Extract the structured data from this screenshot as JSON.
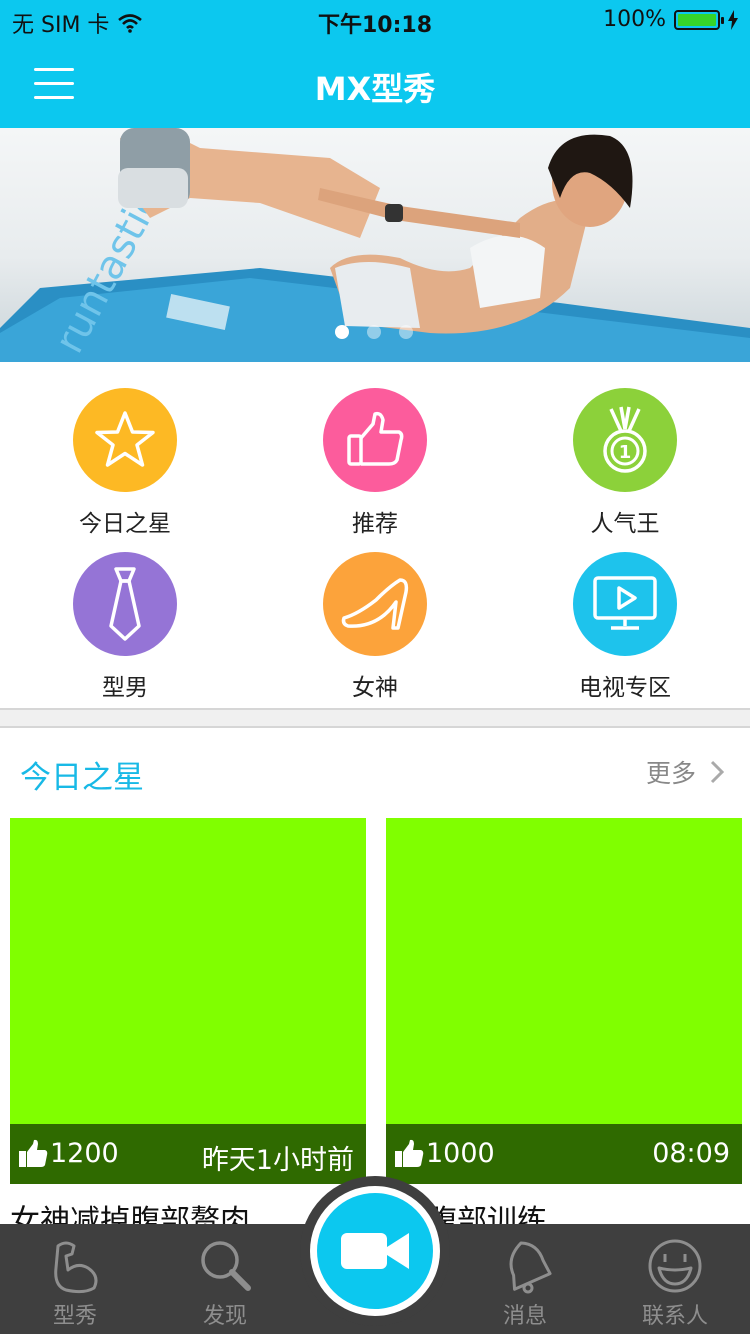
{
  "status_bar": {
    "carrier": "无 SIM 卡",
    "time": "下午10:18",
    "battery": "100%"
  },
  "nav": {
    "title": "MX型秀"
  },
  "banner": {
    "slides": 3,
    "active_slide": 1,
    "mat_brand": "runtastic"
  },
  "categories": [
    {
      "label": "今日之星",
      "icon": "star-icon",
      "color": "#fdb924"
    },
    {
      "label": "推荐",
      "icon": "thumbs-up-icon",
      "color": "#fc5c9c"
    },
    {
      "label": "人气王",
      "icon": "medal-icon",
      "color": "#8cd13a"
    },
    {
      "label": "型男",
      "icon": "tie-icon",
      "color": "#9574d6"
    },
    {
      "label": "女神",
      "icon": "high-heel-icon",
      "color": "#fca33b"
    },
    {
      "label": "电视专区",
      "icon": "tv-play-icon",
      "color": "#1ec3ec"
    }
  ],
  "section": {
    "title": "今日之星",
    "more": "更多"
  },
  "cards": [
    {
      "likes": "1200",
      "time": "昨天1小时前",
      "title": "女神减掉腹部赘肉"
    },
    {
      "likes": "1000",
      "time": "08:09",
      "title": "腹部训练"
    }
  ],
  "tabs": [
    {
      "label": "型秀",
      "icon": "muscle-arm-icon"
    },
    {
      "label": "发现",
      "icon": "search-icon"
    },
    {
      "label": "消息",
      "icon": "bell-icon"
    },
    {
      "label": "联系人",
      "icon": "smiley-icon"
    }
  ],
  "record_button": {
    "icon": "video-camera-icon"
  },
  "colors": {
    "primary": "#0cc8ef",
    "accent_text": "#18b9e6",
    "card_bg": "#80ff00",
    "card_meta_bg": "#2f6a00",
    "tab_bar_bg": "#3f3f3f"
  }
}
